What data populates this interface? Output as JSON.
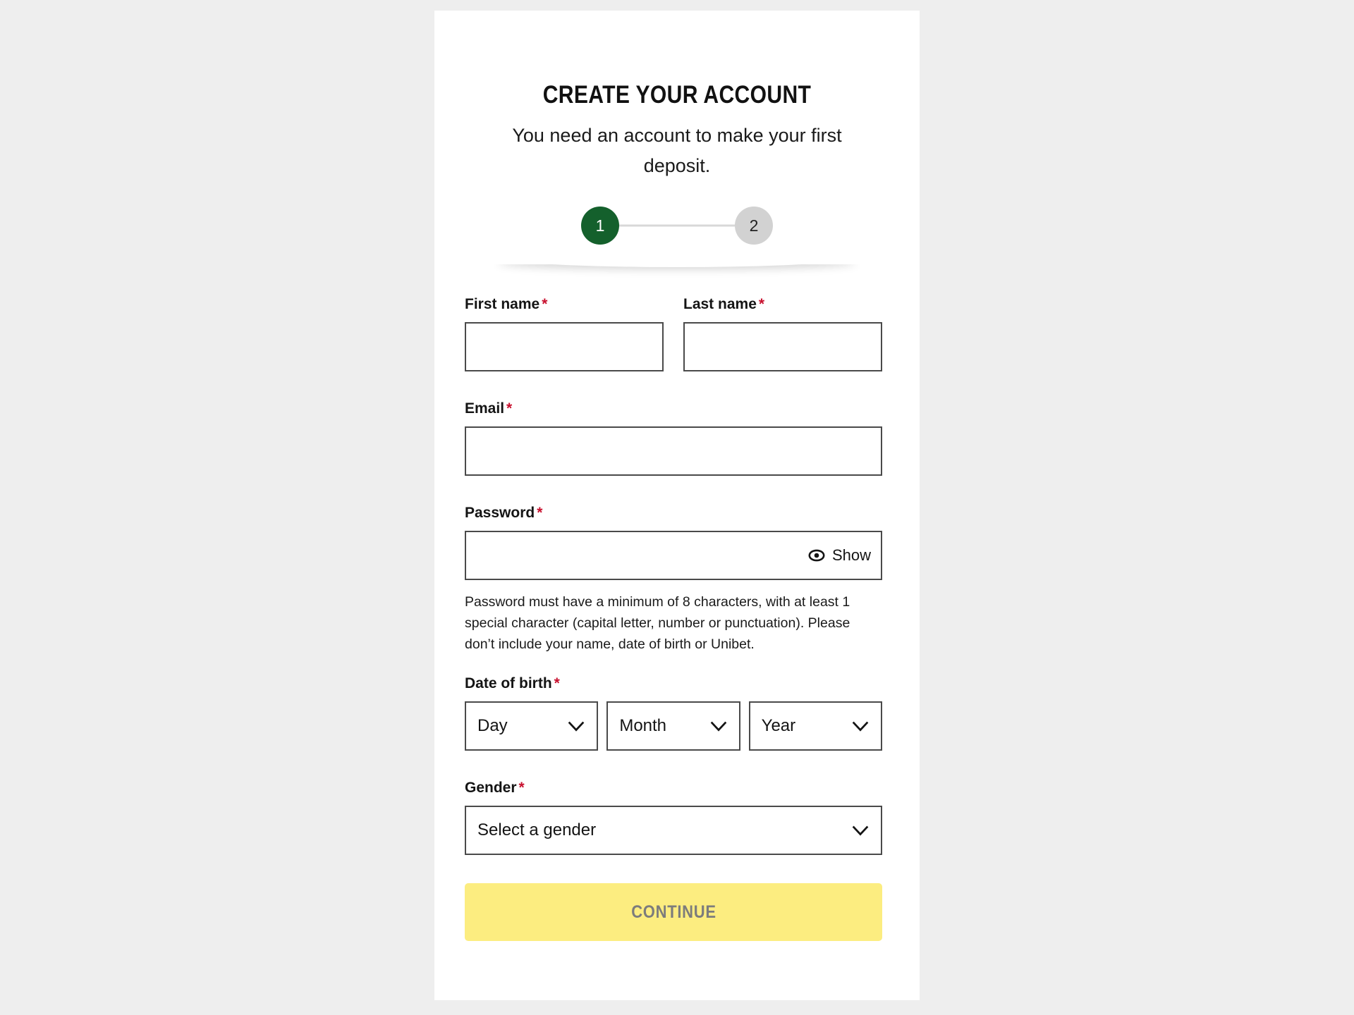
{
  "page": {
    "background_color": "#eeeeee",
    "card_background": "#ffffff"
  },
  "header": {
    "title": "CREATE YOUR ACCOUNT",
    "subtitle": "You need an account to make your first deposit."
  },
  "stepper": {
    "active_color": "#14602c",
    "inactive_color": "#d2d2d2",
    "steps": [
      {
        "label": "1",
        "state": "active"
      },
      {
        "label": "2",
        "state": "inactive"
      }
    ]
  },
  "form": {
    "required_marker": "*",
    "required_color": "#c8102e",
    "first_name": {
      "label": "First name",
      "value": "",
      "placeholder": ""
    },
    "last_name": {
      "label": "Last name",
      "value": "",
      "placeholder": ""
    },
    "email": {
      "label": "Email",
      "value": "",
      "placeholder": ""
    },
    "password": {
      "label": "Password",
      "value": "",
      "placeholder": "",
      "show_label": "Show",
      "help": "Password must have a minimum of 8 characters, with at least 1 special character (capital letter, number or punctuation). Please don’t include your name, date of birth or Unibet."
    },
    "date_of_birth": {
      "label": "Date of birth",
      "day": {
        "selected": "Day"
      },
      "month": {
        "selected": "Month"
      },
      "year": {
        "selected": "Year"
      }
    },
    "gender": {
      "label": "Gender",
      "selected": "Select a gender"
    }
  },
  "actions": {
    "continue": {
      "label": "CONTINUE",
      "background_color": "#fced80",
      "text_color": "#7c7c7c",
      "enabled": false
    }
  }
}
